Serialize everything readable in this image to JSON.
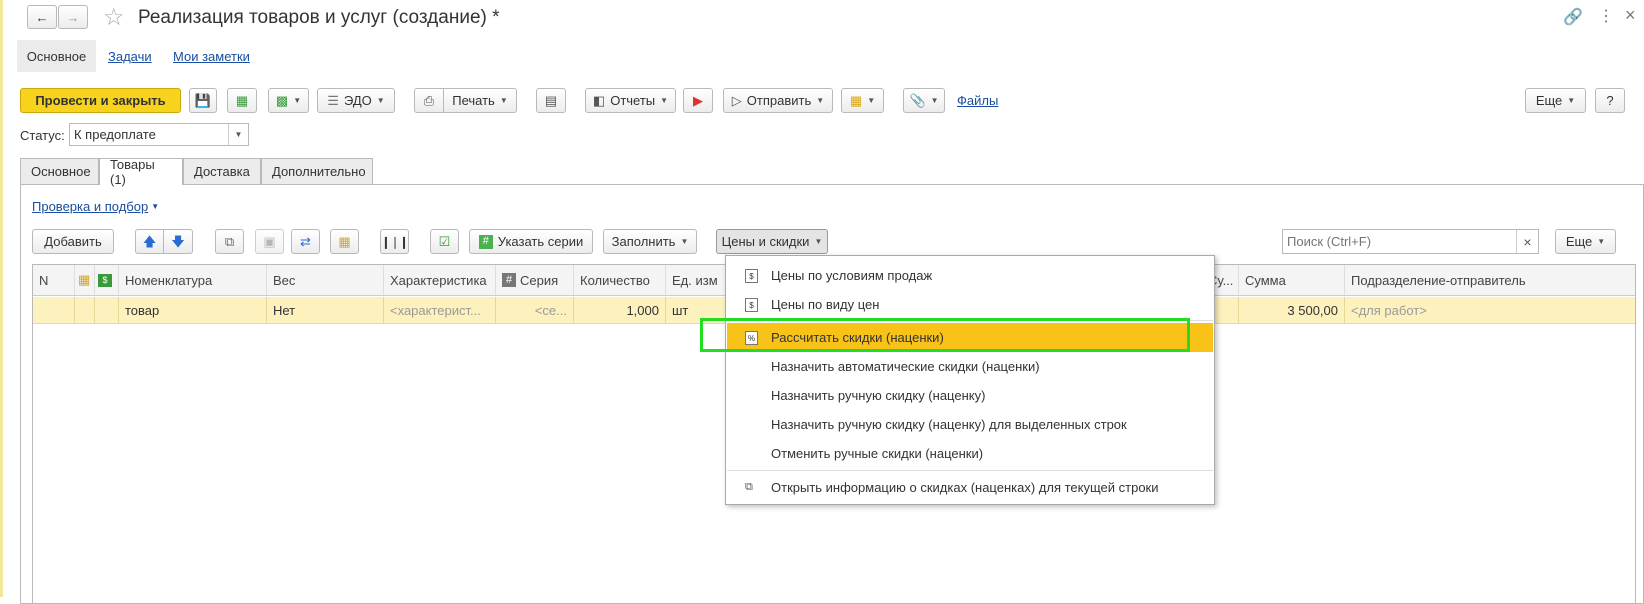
{
  "window": {
    "title": "Реализация товаров и услуг (создание) *"
  },
  "section_tabs": [
    "Основное",
    "Задачи",
    "Мои заметки"
  ],
  "toolbar": {
    "post_close": "Провести и закрыть",
    "edo": "ЭДО",
    "print": "Печать",
    "reports": "Отчеты",
    "send": "Отправить",
    "files": "Файлы",
    "more": "Еще",
    "help": "?"
  },
  "status": {
    "label": "Статус:",
    "value": "К предоплате"
  },
  "doc_tabs": [
    "Основное",
    "Товары (1)",
    "Доставка",
    "Дополнительно"
  ],
  "goods_toolbar": {
    "check_link": "Проверка и подбор",
    "add": "Добавить",
    "series": "Указать серии",
    "fill": "Заполнить",
    "prices": "Цены и скидки",
    "search_placeholder": "Поиск (Ctrl+F)",
    "search_clear": "×",
    "more": "Еще"
  },
  "table": {
    "columns": {
      "n": "N",
      "nomenclature": "Номенклатура",
      "weight": "Вес",
      "characteristic": "Характеристика",
      "series": "Серия",
      "quantity": "Количество",
      "unit": "Ед. изм",
      "su": "Су...",
      "sum": "Сумма",
      "division": "Подразделение-отправитель"
    },
    "row": {
      "nomenclature": "товар",
      "weight": "Нет",
      "characteristic": "<характерист...",
      "series": "<се...",
      "quantity": "1,000",
      "unit": "шт",
      "sum": "3 500,00",
      "division": "<для работ>"
    }
  },
  "menu": {
    "items": [
      "Цены по условиям продаж",
      "Цены по виду цен",
      "Рассчитать скидки (наценки)",
      "Назначить автоматические скидки (наценки)",
      "Назначить ручную скидку (наценку)",
      "Назначить ручную скидку (наценку) для выделенных строк",
      "Отменить ручные скидки (наценки)",
      "Открыть информацию о скидках (наценках) для текущей строки"
    ],
    "highlight_color": "#f8c219",
    "annotation_color": "#22dd22"
  },
  "colors": {
    "primary_button": "#f8d31e",
    "row_selected": "#fdf1bd",
    "link": "#1a4ea0"
  }
}
